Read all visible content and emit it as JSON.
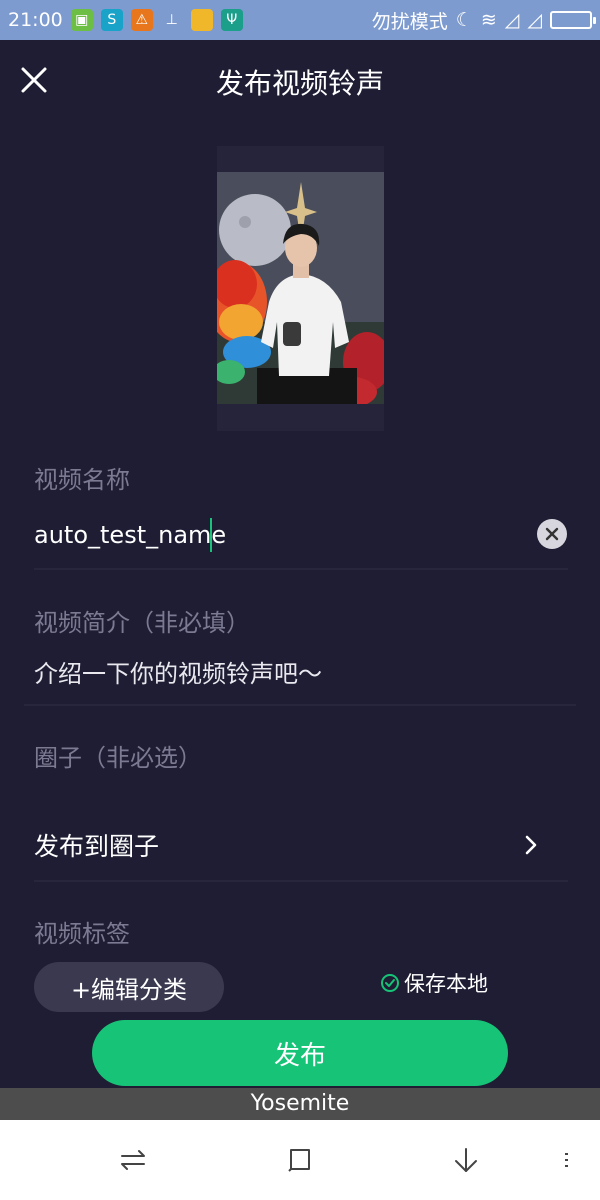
{
  "status_bar": {
    "time": "21:00",
    "dnd_label": "勿扰模式",
    "app_icons": [
      "android-update-icon",
      "sync-app-icon",
      "warning-icon",
      "cleaner-icon",
      "folder-icon",
      "usb-icon"
    ]
  },
  "header": {
    "title": "发布视频铃声"
  },
  "form": {
    "name_label": "视频名称",
    "name_value": "auto_test_name",
    "intro_label": "视频简介（非必填）",
    "intro_placeholder": "介绍一下你的视频铃声吧～",
    "circle_label": "圈子（非必选）",
    "circle_action": "发布到圈子",
    "tags_label": "视频标签",
    "edit_category_label": "+编辑分类",
    "save_local_label": "保存本地"
  },
  "publish_label": "发布",
  "overlay_label": "Yosemite",
  "colors": {
    "background": "#1e1d33",
    "accent": "#17c377",
    "status_bar": "#7d9bcf"
  }
}
